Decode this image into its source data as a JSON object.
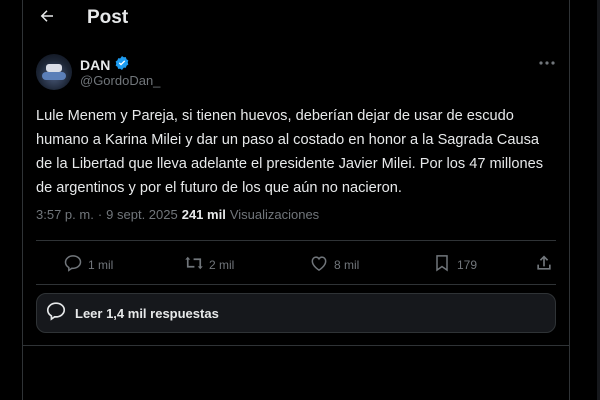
{
  "header": {
    "title": "Post",
    "back_icon": "arrow-left-icon"
  },
  "author": {
    "name": "DAN",
    "handle": "@GordoDan_",
    "verified_icon": "verified-badge-icon",
    "verified_color": "#1d9bf0"
  },
  "tweet": {
    "text": "Lule Menem y Pareja, si tienen huevos, deberían dejar de usar de escudo humano a Karina Milei y dar un paso al costado en honor a la Sagrada Causa de la Libertad que lleva adelante el presidente Javier Milei. Por los 47 millones de argentinos y por el futuro de los que aún no nacieron.",
    "time": "3:57 p. m.",
    "separator": "·",
    "date": "9 sept. 2025",
    "views_count": "241 mil",
    "views_label": "Visualizaciones"
  },
  "actions": {
    "reply": {
      "icon": "reply-icon",
      "count": "1 mil"
    },
    "repost": {
      "icon": "repost-icon",
      "count": "2 mil"
    },
    "like": {
      "icon": "heart-icon",
      "count": "8 mil"
    },
    "bookmark": {
      "icon": "bookmark-icon",
      "count": "179"
    },
    "share": {
      "icon": "share-icon"
    }
  },
  "replies_button": {
    "icon": "speech-bubble-icon",
    "label": "Leer 1,4 mil respuestas"
  },
  "colors": {
    "background": "#000000",
    "text": "#e7e9ea",
    "muted": "#71767b",
    "border": "#2f3336"
  }
}
